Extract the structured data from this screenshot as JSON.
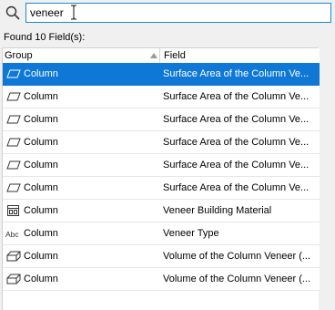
{
  "search": {
    "value": "veneer"
  },
  "status": {
    "found_text": "Found 10 Field(s):"
  },
  "columns": {
    "group": "Group",
    "field": "Field"
  },
  "rows": [
    {
      "icon": "parallelogram-icon",
      "group": "Column",
      "field": "Surface Area of the Column Ve...",
      "selected": true
    },
    {
      "icon": "parallelogram-icon",
      "group": "Column",
      "field": "Surface Area of the Column Ve...",
      "selected": false
    },
    {
      "icon": "parallelogram-icon",
      "group": "Column",
      "field": "Surface Area of the Column Ve...",
      "selected": false
    },
    {
      "icon": "parallelogram-icon",
      "group": "Column",
      "field": "Surface Area of the Column Ve...",
      "selected": false
    },
    {
      "icon": "parallelogram-icon",
      "group": "Column",
      "field": "Surface Area of the Column Ve...",
      "selected": false
    },
    {
      "icon": "parallelogram-icon",
      "group": "Column",
      "field": "Surface Area of the Column Ve...",
      "selected": false
    },
    {
      "icon": "building-material-icon",
      "group": "Column",
      "field": "Veneer Building Material",
      "selected": false
    },
    {
      "icon": "text-abc-icon",
      "group": "Column",
      "field": "Veneer Type",
      "selected": false
    },
    {
      "icon": "volume-icon",
      "group": "Column",
      "field": "Volume of the Column Veneer (...",
      "selected": false
    },
    {
      "icon": "volume-icon",
      "group": "Column",
      "field": "Volume of the Column Veneer (...",
      "selected": false
    }
  ],
  "colors": {
    "selection": "#0f78d7",
    "focus_border": "#1c87d8"
  }
}
